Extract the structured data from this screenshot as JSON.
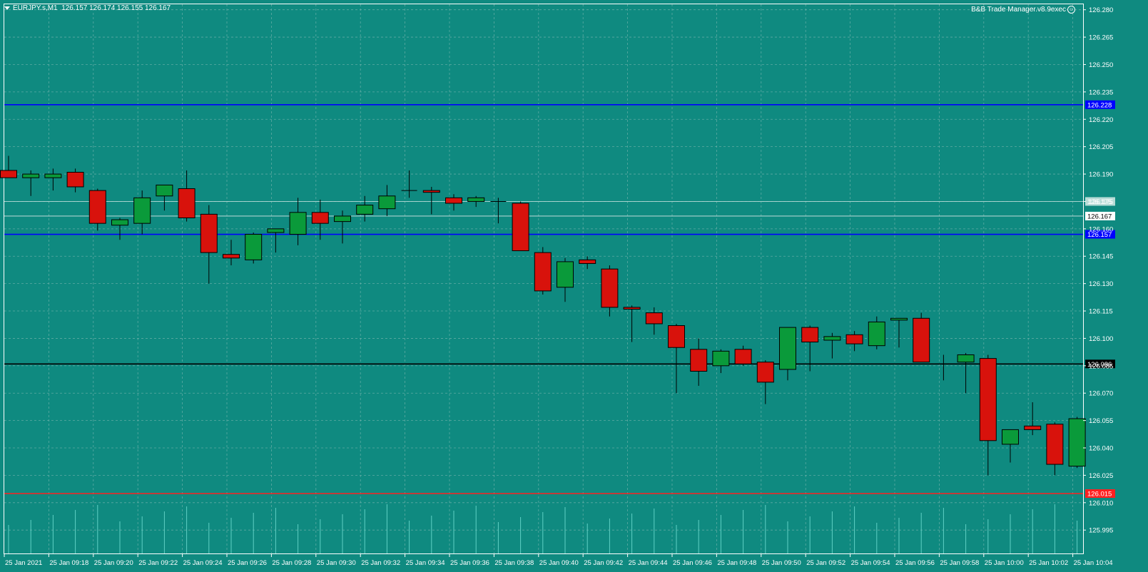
{
  "header": {
    "symbol": "EURJPY.s,M1",
    "ohlc": "126.157 126.174 126.155 126.167"
  },
  "expert": {
    "label": "B&B Trade Manager.v8.9exec",
    "icon": "smiley-icon"
  },
  "colors": {
    "background": "#0f8a80",
    "grid": "#7fb9b3",
    "bull": "#0a9a3a",
    "bear": "#d8120c",
    "wick": "#000000",
    "axis_text": "#ffffff",
    "blue_line": "#0000ff",
    "red_line": "#ff2020",
    "black_line": "#000000"
  },
  "chart_data": {
    "type": "candlestick",
    "y_ticks": [
      "126.280",
      "126.265",
      "126.250",
      "126.235",
      "126.220",
      "126.205",
      "126.190",
      "126.175",
      "126.160",
      "126.145",
      "126.130",
      "126.115",
      "126.100",
      "126.085",
      "126.070",
      "126.055",
      "126.040",
      "126.025",
      "126.010",
      "125.995"
    ],
    "ylim": [
      125.99,
      126.283
    ],
    "x_labels": [
      "25 Jan 2021",
      "25 Jan 09:18",
      "25 Jan 09:20",
      "25 Jan 09:22",
      "25 Jan 09:24",
      "25 Jan 09:26",
      "25 Jan 09:28",
      "25 Jan 09:30",
      "25 Jan 09:32",
      "25 Jan 09:34",
      "25 Jan 09:36",
      "25 Jan 09:38",
      "25 Jan 09:40",
      "25 Jan 09:42",
      "25 Jan 09:44",
      "25 Jan 09:46",
      "25 Jan 09:48",
      "25 Jan 09:50",
      "25 Jan 09:52",
      "25 Jan 09:54",
      "25 Jan 09:56",
      "25 Jan 09:58",
      "25 Jan 10:00",
      "25 Jan 10:02",
      "25 Jan 10:04"
    ],
    "candles": [
      {
        "o": 126.192,
        "h": 126.2,
        "l": 126.188,
        "c": 126.188
      },
      {
        "o": 126.188,
        "h": 126.192,
        "l": 126.178,
        "c": 126.19
      },
      {
        "o": 126.188,
        "h": 126.193,
        "l": 126.181,
        "c": 126.19
      },
      {
        "o": 126.191,
        "h": 126.193,
        "l": 126.18,
        "c": 126.183
      },
      {
        "o": 126.181,
        "h": 126.182,
        "l": 126.159,
        "c": 126.163
      },
      {
        "o": 126.162,
        "h": 126.166,
        "l": 126.154,
        "c": 126.165
      },
      {
        "o": 126.163,
        "h": 126.181,
        "l": 126.157,
        "c": 126.177
      },
      {
        "o": 126.178,
        "h": 126.184,
        "l": 126.17,
        "c": 126.184
      },
      {
        "o": 126.182,
        "h": 126.192,
        "l": 126.164,
        "c": 126.166
      },
      {
        "o": 126.168,
        "h": 126.173,
        "l": 126.13,
        "c": 126.147
      },
      {
        "o": 126.146,
        "h": 126.154,
        "l": 126.14,
        "c": 126.144
      },
      {
        "o": 126.143,
        "h": 126.158,
        "l": 126.141,
        "c": 126.157
      },
      {
        "o": 126.158,
        "h": 126.159,
        "l": 126.147,
        "c": 126.16
      },
      {
        "o": 126.157,
        "h": 126.177,
        "l": 126.151,
        "c": 126.169
      },
      {
        "o": 126.169,
        "h": 126.176,
        "l": 126.154,
        "c": 126.163
      },
      {
        "o": 126.164,
        "h": 126.17,
        "l": 126.152,
        "c": 126.167
      },
      {
        "o": 126.168,
        "h": 126.178,
        "l": 126.164,
        "c": 126.173
      },
      {
        "o": 126.171,
        "h": 126.184,
        "l": 126.167,
        "c": 126.178
      },
      {
        "o": 126.181,
        "h": 126.192,
        "l": 126.177,
        "c": 126.181
      },
      {
        "o": 126.181,
        "h": 126.183,
        "l": 126.168,
        "c": 126.18
      },
      {
        "o": 126.177,
        "h": 126.179,
        "l": 126.17,
        "c": 126.174
      },
      {
        "o": 126.175,
        "h": 126.178,
        "l": 126.172,
        "c": 126.177
      },
      {
        "o": 126.175,
        "h": 126.177,
        "l": 126.163,
        "c": 126.175
      },
      {
        "o": 126.174,
        "h": 126.175,
        "l": 126.149,
        "c": 126.148
      },
      {
        "o": 126.147,
        "h": 126.15,
        "l": 126.124,
        "c": 126.126
      },
      {
        "o": 126.128,
        "h": 126.144,
        "l": 126.12,
        "c": 126.142
      },
      {
        "o": 126.143,
        "h": 126.145,
        "l": 126.138,
        "c": 126.141
      },
      {
        "o": 126.138,
        "h": 126.14,
        "l": 126.112,
        "c": 126.117
      },
      {
        "o": 126.117,
        "h": 126.118,
        "l": 126.098,
        "c": 126.116
      },
      {
        "o": 126.114,
        "h": 126.117,
        "l": 126.102,
        "c": 126.108
      },
      {
        "o": 126.107,
        "h": 126.108,
        "l": 126.07,
        "c": 126.095
      },
      {
        "o": 126.094,
        "h": 126.1,
        "l": 126.074,
        "c": 126.082
      },
      {
        "o": 126.085,
        "h": 126.094,
        "l": 126.081,
        "c": 126.093
      },
      {
        "o": 126.094,
        "h": 126.096,
        "l": 126.085,
        "c": 126.086
      },
      {
        "o": 126.087,
        "h": 126.088,
        "l": 126.064,
        "c": 126.076
      },
      {
        "o": 126.083,
        "h": 126.106,
        "l": 126.077,
        "c": 126.106
      },
      {
        "o": 126.106,
        "h": 126.107,
        "l": 126.082,
        "c": 126.098
      },
      {
        "o": 126.099,
        "h": 126.103,
        "l": 126.089,
        "c": 126.101
      },
      {
        "o": 126.102,
        "h": 126.104,
        "l": 126.093,
        "c": 126.097
      },
      {
        "o": 126.096,
        "h": 126.112,
        "l": 126.094,
        "c": 126.109
      },
      {
        "o": 126.11,
        "h": 126.111,
        "l": 126.095,
        "c": 126.111
      },
      {
        "o": 126.111,
        "h": 126.114,
        "l": 126.087,
        "c": 126.087
      },
      {
        "o": 126.086,
        "h": 126.091,
        "l": 126.077,
        "c": 126.086
      },
      {
        "o": 126.087,
        "h": 126.092,
        "l": 126.07,
        "c": 126.091
      },
      {
        "o": 126.089,
        "h": 126.091,
        "l": 126.025,
        "c": 126.044
      },
      {
        "o": 126.042,
        "h": 126.05,
        "l": 126.032,
        "c": 126.05
      },
      {
        "o": 126.052,
        "h": 126.065,
        "l": 126.047,
        "c": 126.05
      },
      {
        "o": 126.053,
        "h": 126.054,
        "l": 126.025,
        "c": 126.031
      },
      {
        "o": 126.03,
        "h": 126.057,
        "l": 126.029,
        "c": 126.056
      }
    ],
    "hlines": [
      {
        "value": 126.228,
        "label": "126.228",
        "color": "#0000ff",
        "label_bg": "#0000ff",
        "label_fg": "#ffffff"
      },
      {
        "value": 126.157,
        "label": "126.157",
        "color": "#0000ff",
        "label_bg": "#0000ff",
        "label_fg": "#ffffff"
      },
      {
        "value": 126.086,
        "label": "126.086",
        "color": "#000000",
        "label_bg": "#000000",
        "label_fg": "#ffffff"
      },
      {
        "value": 126.015,
        "label": "126.015",
        "color": "#ff2020",
        "label_bg": "#ff2020",
        "label_fg": "#ffffff"
      }
    ],
    "ask_line": {
      "value": 126.175,
      "label": "126.175"
    },
    "bid_line": {
      "value": 126.167,
      "label": "126.167"
    }
  }
}
